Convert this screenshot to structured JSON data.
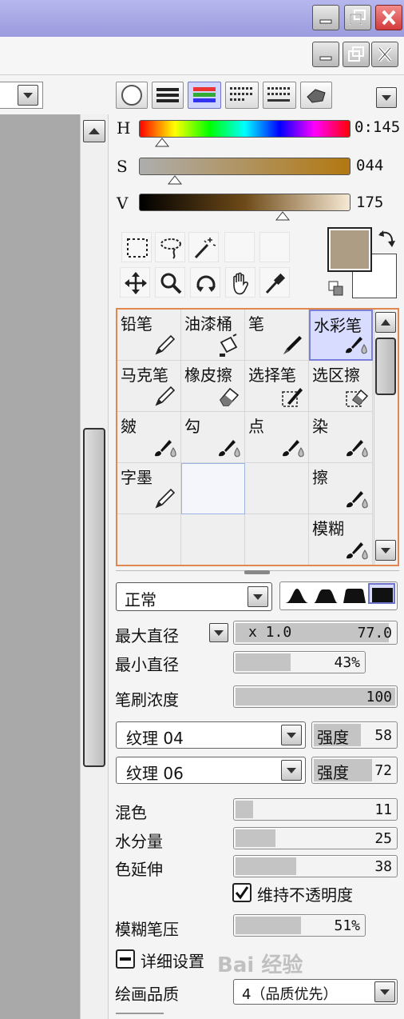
{
  "color": {
    "h_label": "H",
    "h_value": "0:145",
    "h_pos": 0.11,
    "s_label": "S",
    "s_value": "044",
    "s_pos": 0.17,
    "v_label": "V",
    "v_value": "175",
    "v_pos": 0.68,
    "fg_color": "#ad9d84",
    "bg_color": "#ffffff"
  },
  "brushes": [
    {
      "label": "铅笔",
      "icon": "pencil"
    },
    {
      "label": "油漆桶",
      "icon": "bucket"
    },
    {
      "label": "笔",
      "icon": "pen"
    },
    {
      "label": "水彩笔",
      "icon": "brush-drop",
      "selected": true
    },
    {
      "label": "马克笔",
      "icon": "pencil"
    },
    {
      "label": "橡皮擦",
      "icon": "eraser"
    },
    {
      "label": "选择笔",
      "icon": "select-pen"
    },
    {
      "label": "选区擦",
      "icon": "select-eraser"
    },
    {
      "label": "皴",
      "icon": "brush-drop"
    },
    {
      "label": "勾",
      "icon": "brush-drop"
    },
    {
      "label": "点",
      "icon": "brush-drop"
    },
    {
      "label": "染",
      "icon": "brush-drop"
    },
    {
      "label": "字墨",
      "icon": "pencil"
    },
    {
      "label": "",
      "icon": "",
      "hover": true
    },
    {
      "label": "",
      "icon": ""
    },
    {
      "label": "擦",
      "icon": "brush-drop"
    },
    {
      "label": "",
      "icon": ""
    },
    {
      "label": "",
      "icon": ""
    },
    {
      "label": "",
      "icon": ""
    },
    {
      "label": "模糊",
      "icon": "brush-drop"
    }
  ],
  "blend_mode": "正常",
  "settings": {
    "max_diameter_label": "最大直径",
    "max_diameter_mult": "x 1.0",
    "max_diameter_value": "77.0",
    "min_diameter_label": "最小直径",
    "min_diameter_value": "43%",
    "min_diameter_fill": 0.43,
    "density_label": "笔刷浓度",
    "density_value": "100",
    "density_fill": 1.0,
    "texture1": "纹理 04",
    "texture1_strength_label": "强度",
    "texture1_strength": "58",
    "texture1_fill": 0.58,
    "texture2": "纹理 06",
    "texture2_strength_label": "强度",
    "texture2_strength": "72",
    "texture2_fill": 0.72,
    "blend_label": "混色",
    "blend_value": "11",
    "blend_fill": 0.11,
    "water_label": "水分量",
    "water_value": "25",
    "water_fill": 0.25,
    "stretch_label": "色延伸",
    "stretch_value": "38",
    "stretch_fill": 0.38,
    "keep_opacity_label": "维持不透明度",
    "keep_opacity_checked": true,
    "blur_pressure_label": "模糊笔压",
    "blur_pressure_value": "51%",
    "blur_pressure_fill": 0.51,
    "detail_label": "详细设置",
    "quality_label": "绘画品质",
    "quality_value": "4（品质优先）"
  },
  "watermark": "Bai 经验"
}
